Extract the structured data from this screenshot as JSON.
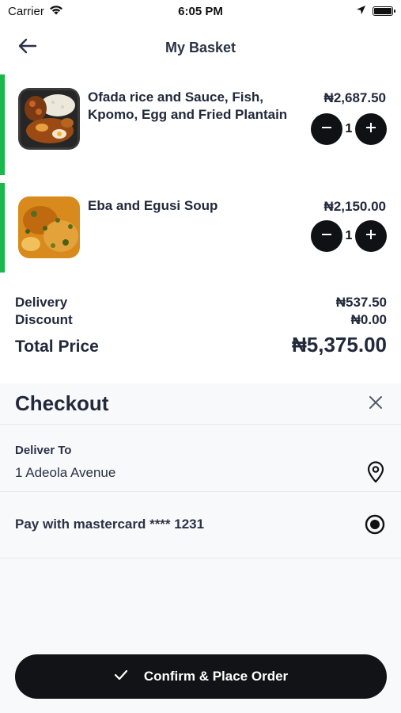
{
  "status_bar": {
    "carrier": "Carrier",
    "time": "6:05 PM"
  },
  "header": {
    "title": "My Basket",
    "back_icon": "arrow-left-icon"
  },
  "basket": {
    "items": [
      {
        "name": "Ofada rice and Sauce, Fish, Kpomo, Egg and Fried Plantain",
        "price": "₦2,687.50",
        "quantity": "1",
        "accent_color": "#18b84a"
      },
      {
        "name": "Eba and Egusi Soup",
        "price": "₦2,150.00",
        "quantity": "1",
        "accent_color": "#18b84a"
      }
    ]
  },
  "summary": {
    "delivery_label": "Delivery",
    "delivery_value": "₦537.50",
    "discount_label": "Discount",
    "discount_value": "₦0.00",
    "total_label": "Total Price",
    "total_value": "₦5,375.00"
  },
  "checkout": {
    "title": "Checkout",
    "deliver_label": "Deliver To",
    "deliver_value": "1 Adeola Avenue",
    "pay_label": "Pay with mastercard **** 1231",
    "confirm_label": "Confirm & Place Order"
  },
  "colors": {
    "accent": "#18b84a",
    "button": "#121316",
    "text": "#22293b"
  }
}
